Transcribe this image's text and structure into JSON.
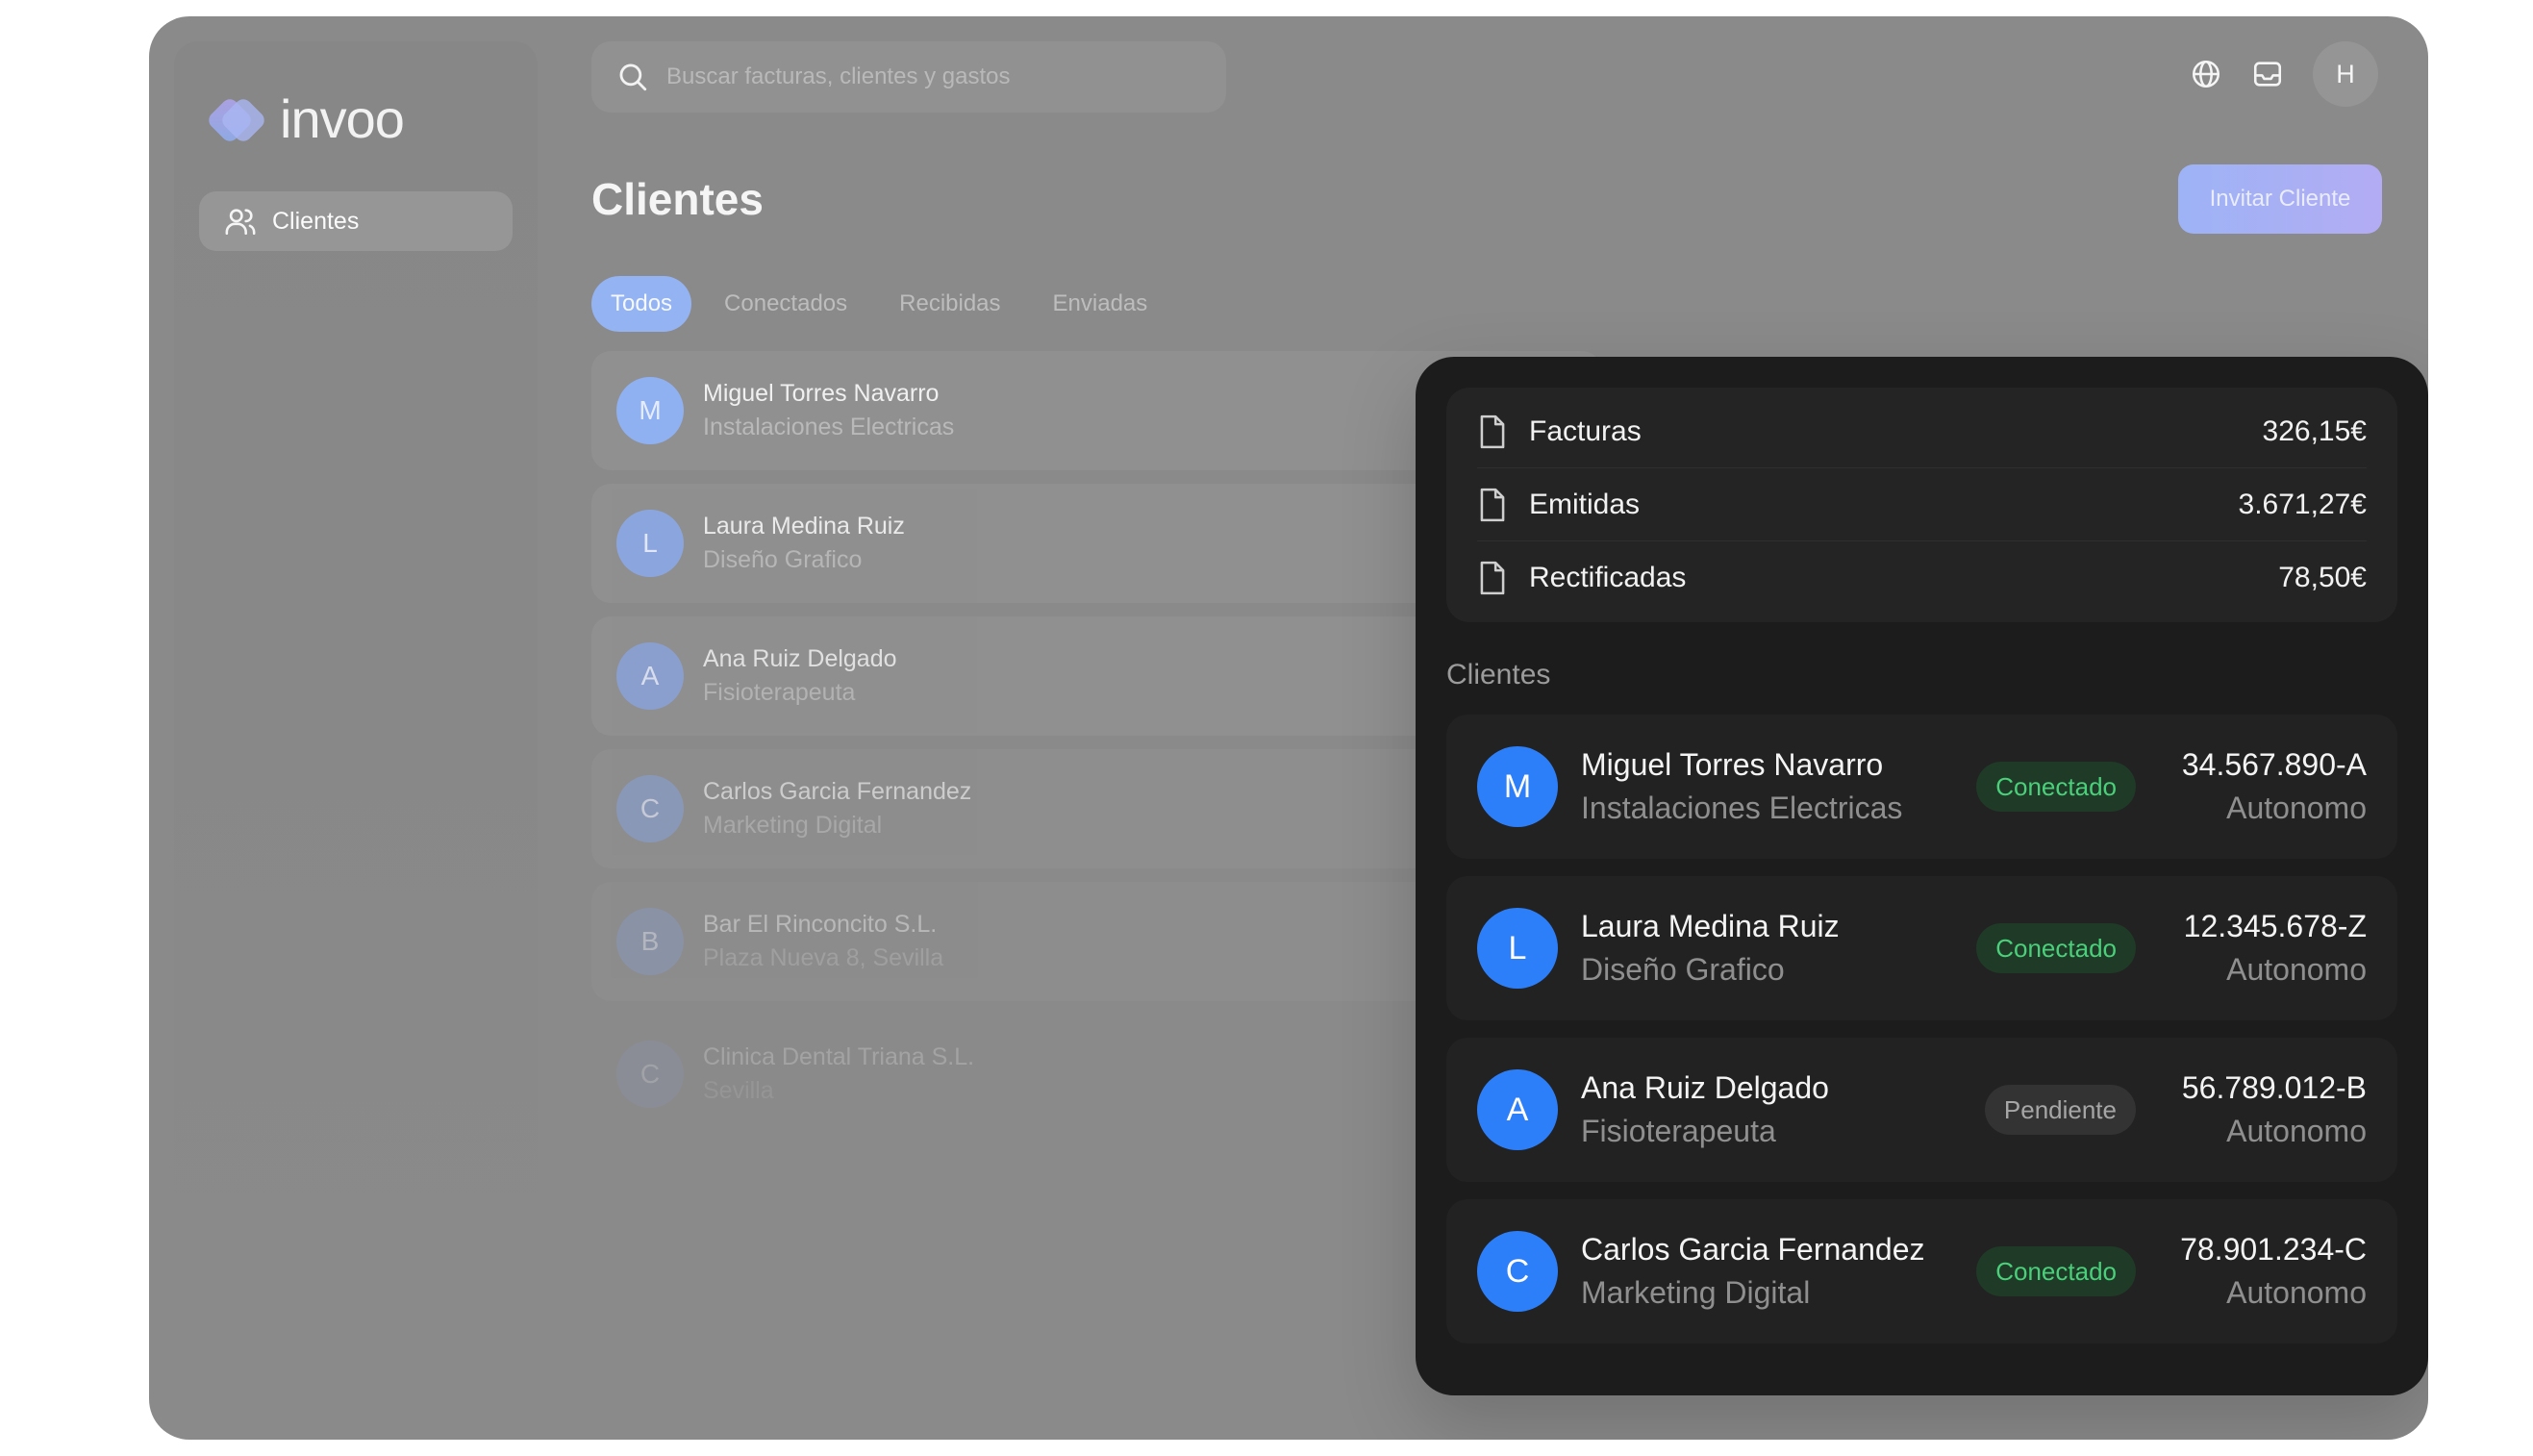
{
  "brand": {
    "name": "invoo"
  },
  "sidebar": {
    "items": [
      {
        "label": "Clientes",
        "icon": "users-icon"
      }
    ]
  },
  "search": {
    "placeholder": "Buscar facturas, clientes y gastos"
  },
  "header": {
    "avatar_initial": "H",
    "icons": [
      "globe-icon",
      "inbox-icon"
    ]
  },
  "page": {
    "title": "Clientes",
    "invite_label": "Invitar Cliente"
  },
  "tabs": [
    "Todos",
    "Conectados",
    "Recibidas",
    "Enviadas"
  ],
  "list": [
    {
      "initial": "M",
      "name": "Miguel Torres Navarro",
      "sub": "Instalaciones Electricas"
    },
    {
      "initial": "L",
      "name": "Laura Medina Ruiz",
      "sub": "Diseño Grafico"
    },
    {
      "initial": "A",
      "name": "Ana Ruiz Delgado",
      "sub": "Fisioterapeuta"
    },
    {
      "initial": "C",
      "name": "Carlos Garcia Fernandez",
      "sub": "Marketing Digital"
    },
    {
      "initial": "B",
      "name": "Bar El Rinconcito S.L.",
      "sub": "Plaza Nueva 8, Sevilla"
    },
    {
      "initial": "C",
      "name": "Clinica Dental Triana S.L.",
      "sub": "Sevilla"
    }
  ],
  "card": {
    "stats": [
      {
        "label": "Facturas",
        "value": "326,15€"
      },
      {
        "label": "Emitidas",
        "value": "3.671,27€"
      },
      {
        "label": "Rectificadas",
        "value": "78,50€"
      }
    ],
    "section_title": "Clientes",
    "clients": [
      {
        "initial": "M",
        "name": "Miguel Torres Navarro",
        "sub": "Instalaciones Electricas",
        "status": "Conectado",
        "nif": "34.567.890-A",
        "type": "Autonomo"
      },
      {
        "initial": "L",
        "name": "Laura Medina Ruiz",
        "sub": "Diseño Grafico",
        "status": "Conectado",
        "nif": "12.345.678-Z",
        "type": "Autonomo"
      },
      {
        "initial": "A",
        "name": "Ana Ruiz Delgado",
        "sub": "Fisioterapeuta",
        "status": "Pendiente",
        "nif": "56.789.012-B",
        "type": "Autonomo"
      },
      {
        "initial": "C",
        "name": "Carlos Garcia Fernandez",
        "sub": "Marketing Digital",
        "status": "Conectado",
        "nif": "78.901.234-C",
        "type": "Autonomo"
      }
    ]
  },
  "colors": {
    "accent": "#2d7ff9",
    "connected_text": "#4ad07a",
    "invite_start": "#9db3f5",
    "invite_end": "#b3acf4"
  }
}
